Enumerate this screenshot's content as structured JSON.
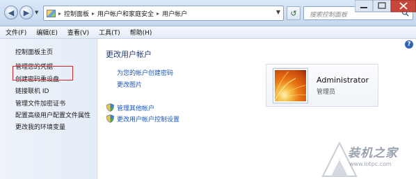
{
  "address": {
    "breadcrumbs": [
      "控制面板",
      "用户帐户和家庭安全",
      "用户帐户"
    ],
    "search_placeholder": "搜索控制面板"
  },
  "menu": [
    "文件(F)",
    "编辑(E)",
    "查看(V)",
    "工具(T)",
    "帮助(H)"
  ],
  "sidebar": {
    "items": [
      {
        "label": "控制面板主页"
      },
      {
        "label": "管理您的凭据"
      },
      {
        "label": "创建密码重设盘"
      },
      {
        "label": "链接联机 ID"
      },
      {
        "label": "管理文件加密证书"
      },
      {
        "label": "配置高级用户配置文件属性"
      },
      {
        "label": "更改我的环境变量"
      }
    ]
  },
  "main": {
    "title": "更改用户帐户",
    "links": [
      {
        "label": "为您的帐户创建密码",
        "icon": null
      },
      {
        "label": "更改图片",
        "icon": null
      },
      {
        "label": "管理其他帐户",
        "icon": "shield-icon"
      },
      {
        "label": "更改用户帐户控制设置",
        "icon": "shield-icon"
      }
    ]
  },
  "user": {
    "name": "Administrator",
    "role": "管理员"
  },
  "watermark": {
    "title": "装机之家",
    "url": "www.lotpc.com"
  },
  "colors": {
    "highlight": "#d7262b",
    "link": "#1a55b5",
    "title": "#1c3a78"
  }
}
